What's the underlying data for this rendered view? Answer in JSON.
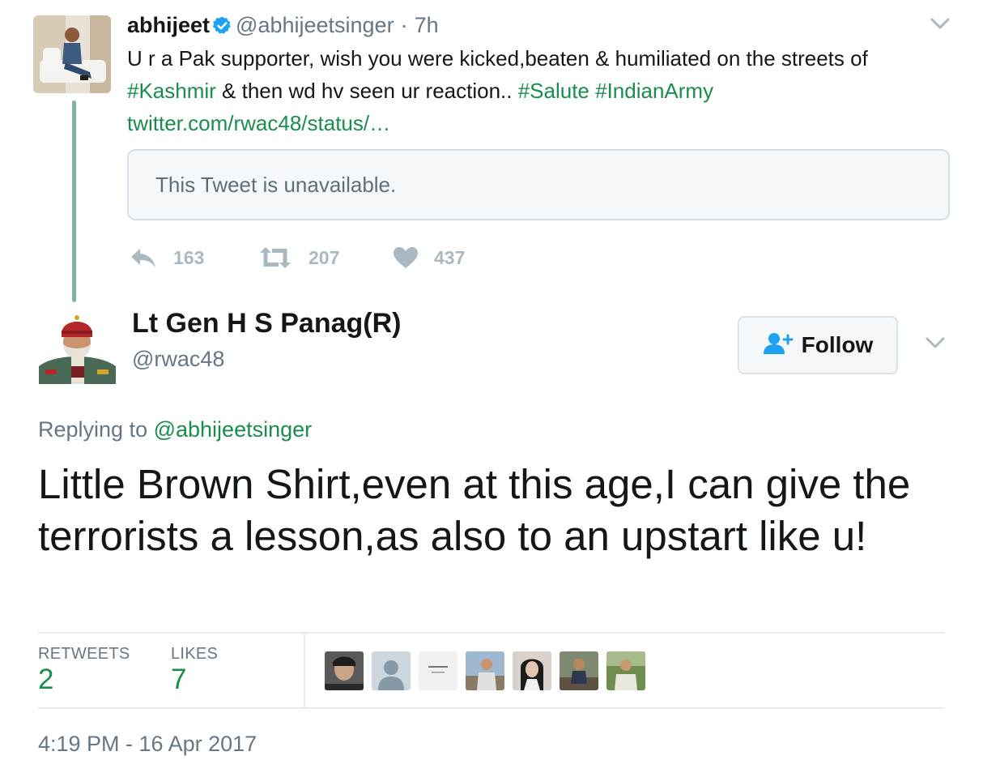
{
  "parent_tweet": {
    "display_name": "abhijeet",
    "handle": "@abhijeetsinger",
    "separator": "·",
    "time": "7h",
    "text_1": "U r a Pak supporter, wish you were kicked,beaten & humiliated on the streets of",
    "hashtag_kashmir": "#Kashmir",
    "text_2": " & then wd hv seen ur reaction.. ",
    "hashtag_salute": "#Salute",
    "hashtag_army": "#IndianArmy",
    "link": "twitter.com/rwac48/status/…",
    "quoted_unavailable": "This Tweet is unavailable.",
    "replies": "163",
    "retweets": "207",
    "likes": "437"
  },
  "main_tweet": {
    "display_name": "Lt Gen H S Panag(R)",
    "handle": "@rwac48",
    "follow_label": "Follow",
    "replying_prefix": "Replying to ",
    "replying_to": "@abhijeetsinger",
    "text": "Little Brown Shirt,even at this age,I can give the terrorists a lesson,as also to an upstart like u!",
    "retweets_label": "RETWEETS",
    "retweets_count": "2",
    "likes_label": "LIKES",
    "likes_count": "7",
    "timestamp": "4:19 PM - 16 Apr 2017"
  },
  "colors": {
    "link": "#1a8d4e",
    "verified": "#1da1f2",
    "muted": "#657786",
    "icon": "#aab8c2",
    "thread_line": "#7fb89a"
  },
  "icons": [
    "verified-badge-icon",
    "chevron-down-icon",
    "reply-icon",
    "retweet-icon",
    "heart-icon",
    "follow-user-plus-icon"
  ]
}
